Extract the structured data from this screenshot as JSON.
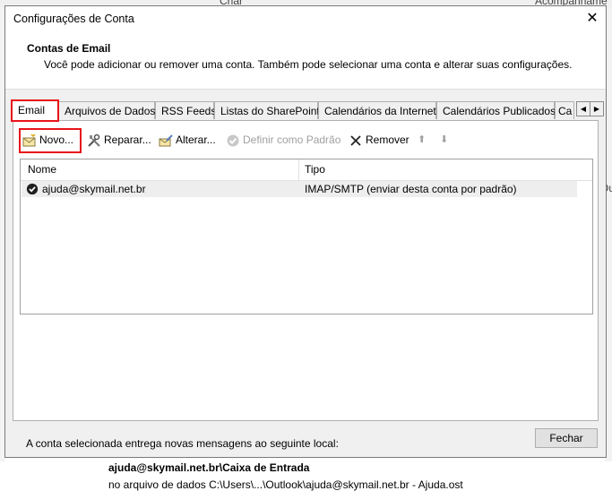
{
  "background": {
    "top_left_text": "Criar",
    "top_right_text": "Acompanhame",
    "right_text": "Ou"
  },
  "dialog": {
    "title": "Configurações de Conta",
    "close_glyph": "✕",
    "header_title": "Contas de Email",
    "header_desc": "Você pode adicionar ou remover uma conta. Também pode selecionar uma conta e alterar suas configurações."
  },
  "tabs": [
    {
      "label": "Email",
      "active": true
    },
    {
      "label": "Arquivos de Dados"
    },
    {
      "label": "RSS Feeds"
    },
    {
      "label": "Listas do SharePoint"
    },
    {
      "label": "Calendários da Internet"
    },
    {
      "label": "Calendários Publicados"
    },
    {
      "label": "Ca"
    }
  ],
  "tab_scroll": {
    "left": "◀",
    "right": "▶"
  },
  "toolbar": {
    "novo": "Novo...",
    "reparar": "Reparar...",
    "alterar": "Alterar...",
    "definir_padrao": "Definir como Padrão",
    "remover": "Remover",
    "up_glyph": "⬆",
    "down_glyph": "⬇"
  },
  "list": {
    "columns": {
      "nome": "Nome",
      "tipo": "Tipo"
    },
    "rows": [
      {
        "nome": "ajuda@skymail.net.br",
        "tipo": "IMAP/SMTP (enviar desta conta por padrão)"
      }
    ]
  },
  "delivery": {
    "label": "A conta selecionada entrega novas mensagens ao seguinte local:",
    "location": "ajuda@skymail.net.br\\Caixa de Entrada",
    "datafile": "no arquivo de dados C:\\Users\\...\\Outlook\\ajuda@skymail.net.br - Ajuda.ost"
  },
  "footer": {
    "close_label": "Fechar"
  },
  "colors": {
    "highlight": "#e8141a",
    "dialog_bg": "#f0f0f0"
  }
}
